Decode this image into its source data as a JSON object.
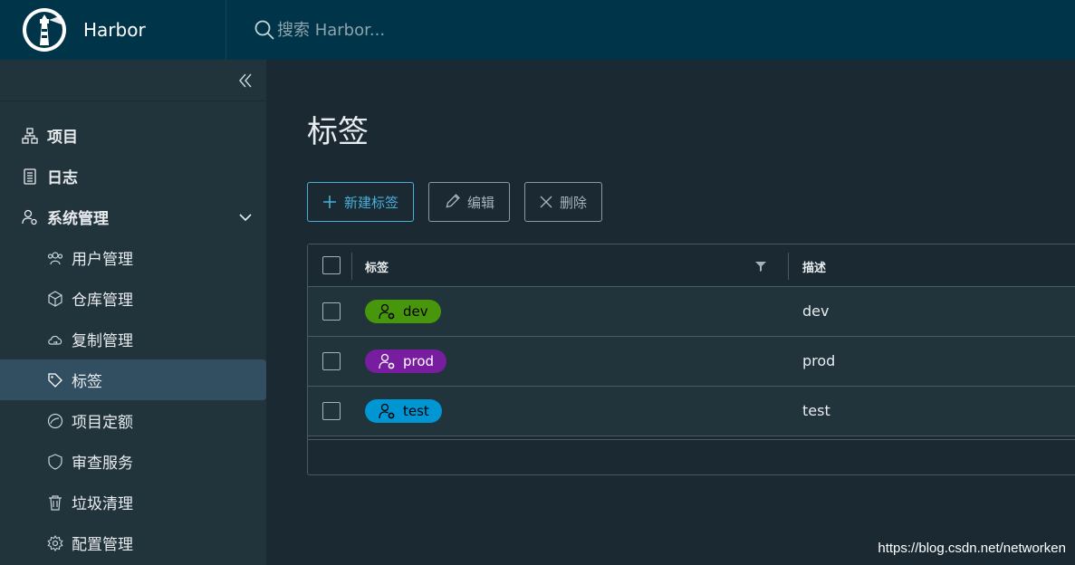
{
  "header": {
    "brand": "Harbor",
    "search_placeholder": "搜索 Harbor..."
  },
  "sidebar": {
    "items": [
      {
        "label": "项目",
        "icon": "org-chart-icon"
      },
      {
        "label": "日志",
        "icon": "log-icon"
      },
      {
        "label": "系统管理",
        "icon": "user-admin-icon"
      }
    ],
    "sub_items": [
      {
        "label": "用户管理",
        "icon": "users-icon"
      },
      {
        "label": "仓库管理",
        "icon": "box-icon"
      },
      {
        "label": "复制管理",
        "icon": "cloud-sync-icon"
      },
      {
        "label": "标签",
        "icon": "tag-icon"
      },
      {
        "label": "项目定额",
        "icon": "gauge-icon"
      },
      {
        "label": "审查服务",
        "icon": "shield-icon"
      },
      {
        "label": "垃圾清理",
        "icon": "trash-icon"
      },
      {
        "label": "配置管理",
        "icon": "gear-icon"
      }
    ]
  },
  "main": {
    "title": "标签",
    "toolbar": {
      "new_label": "新建标签",
      "edit_label": "编辑",
      "delete_label": "删除"
    },
    "grid": {
      "col_label": "标签",
      "col_desc": "描述",
      "rows": [
        {
          "label": "dev",
          "desc": "dev",
          "color": "#48960c",
          "text_color": "#000000"
        },
        {
          "label": "prod",
          "desc": "prod",
          "color": "#781da0",
          "text_color": "#ffffff"
        },
        {
          "label": "test",
          "desc": "test",
          "color": "#0095d3",
          "text_color": "#000000"
        }
      ]
    }
  },
  "watermark": "https://blog.csdn.net/networken",
  "colors": {
    "header_bg": "#003549",
    "sidebar_bg": "#21333b",
    "content_bg": "#1b2a32",
    "accent": "#49afd9",
    "active_item": "#324f62"
  }
}
